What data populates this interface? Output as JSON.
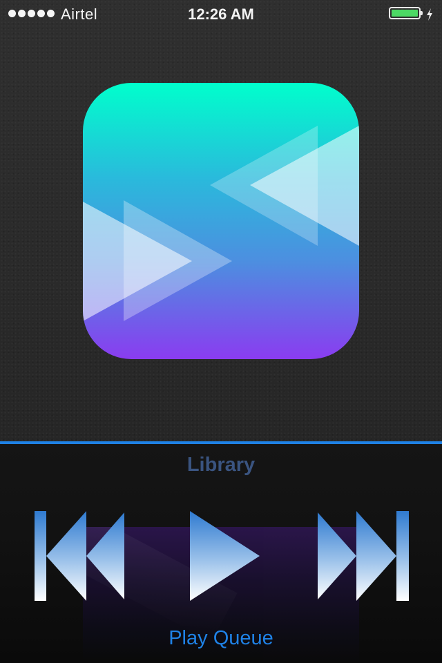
{
  "status_bar": {
    "signal_bars": 5,
    "carrier": "Airtel",
    "time": "12:26 AM",
    "battery_level": 1.0,
    "charging": true
  },
  "artwork": {
    "icon": "fast-forward-rewind-logo-icon",
    "gradient_colors": [
      "#00ffcc",
      "#2ab9dc",
      "#4d8ee0",
      "#8a3cf0"
    ]
  },
  "library": {
    "label": "Library"
  },
  "controls": {
    "previous_icon": "previous-track-icon",
    "play_icon": "play-icon",
    "next_icon": "next-track-icon"
  },
  "queue": {
    "label": "Play Queue"
  },
  "colors": {
    "accent": "#1f82e6",
    "library_label": "#3a5480",
    "battery_fill": "#4cd964"
  }
}
